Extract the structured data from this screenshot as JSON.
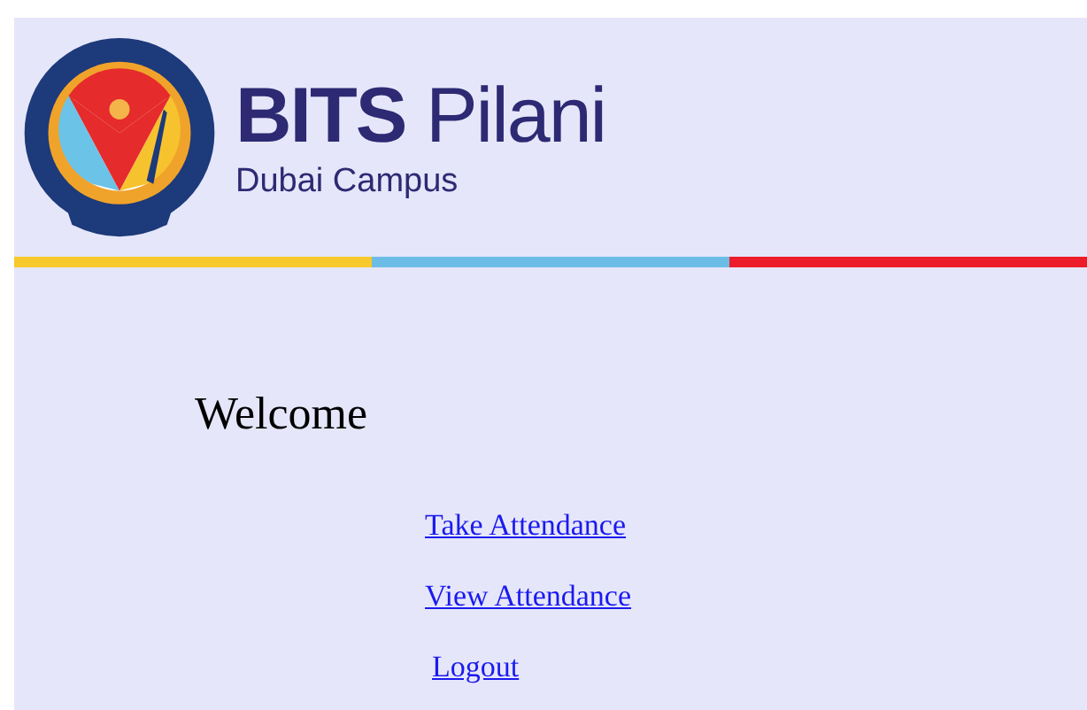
{
  "header": {
    "logo_text": "**BITS** Pilani",
    "subtitle": "Dubai Campus"
  },
  "stripe": [
    {
      "color": "#f8c92c"
    },
    {
      "color": "#6cbde6"
    },
    {
      "color": "#ec1c2b"
    }
  ],
  "welcome": "Welcome",
  "links": [
    {
      "label": "Take Attendance"
    },
    {
      "label": "View Attendance"
    },
    {
      "label": "Logout"
    }
  ]
}
